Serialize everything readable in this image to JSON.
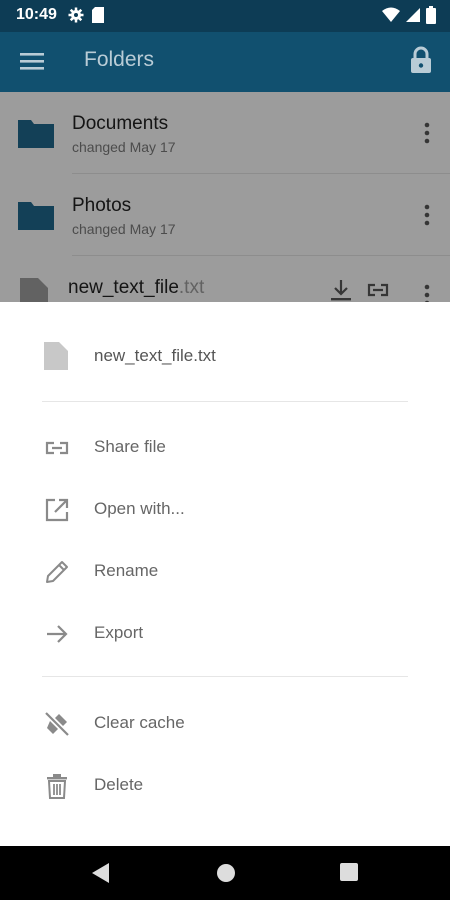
{
  "status_bar": {
    "time": "10:49"
  },
  "app_bar": {
    "title": "Folders"
  },
  "list": {
    "items": [
      {
        "name": "Documents",
        "subtitle": "changed May 17"
      },
      {
        "name": "Photos",
        "subtitle": "changed May 17"
      },
      {
        "name": "new_text_file",
        "extension": ".txt"
      }
    ]
  },
  "bottom_sheet": {
    "file_name": "new_text_file.txt",
    "actions": [
      {
        "label": "Share file",
        "icon": "share-link-icon"
      },
      {
        "label": "Open with...",
        "icon": "open-external-icon"
      },
      {
        "label": "Rename",
        "icon": "pencil-icon"
      },
      {
        "label": "Export",
        "icon": "arrow-right-icon"
      }
    ],
    "secondary_actions": [
      {
        "label": "Clear cache",
        "icon": "clear-cache-icon"
      },
      {
        "label": "Delete",
        "icon": "trash-icon"
      }
    ]
  },
  "colors": {
    "status_bar": "#0d3c55",
    "app_bar": "#11506f",
    "folder": "#1f6489",
    "icon_gray": "#8a8a8a"
  }
}
